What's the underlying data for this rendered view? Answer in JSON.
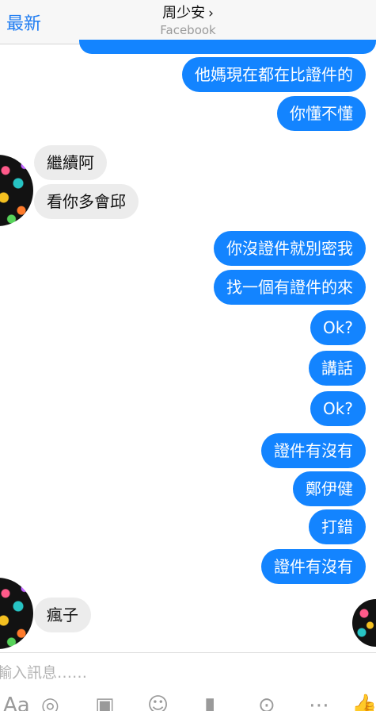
{
  "header": {
    "back_label": "最新",
    "contact_name": "周少安",
    "chevron": "›",
    "subtitle": "Facebook"
  },
  "messages": [
    {
      "text": "他媽現在都在比證件的",
      "side": "out"
    },
    {
      "text": "你懂不懂",
      "side": "out"
    },
    {
      "text": "繼續阿",
      "side": "in"
    },
    {
      "text": "看你多會邱",
      "side": "in"
    },
    {
      "text": "你沒證件就別密我",
      "side": "out"
    },
    {
      "text": "找一個有證件的來",
      "side": "out"
    },
    {
      "text": "Ok?",
      "side": "out"
    },
    {
      "text": "講話",
      "side": "out"
    },
    {
      "text": "Ok?",
      "side": "out"
    },
    {
      "text": "證件有沒有",
      "side": "out"
    },
    {
      "text": "鄭伊健",
      "side": "out"
    },
    {
      "text": "打錯",
      "side": "out"
    },
    {
      "text": "證件有沒有",
      "side": "out"
    },
    {
      "text": "瘋子",
      "side": "in"
    }
  ],
  "composer": {
    "placeholder": "輸入訊息……"
  },
  "toolbar_icons": [
    "camera-icon",
    "gallery-icon",
    "sticker-icon",
    "microphone-icon",
    "location-icon",
    "like-icon"
  ],
  "colors": {
    "accent": "#1e7cf2",
    "outgoing_bubble": "#1384ff",
    "incoming_bubble": "#ececec"
  }
}
